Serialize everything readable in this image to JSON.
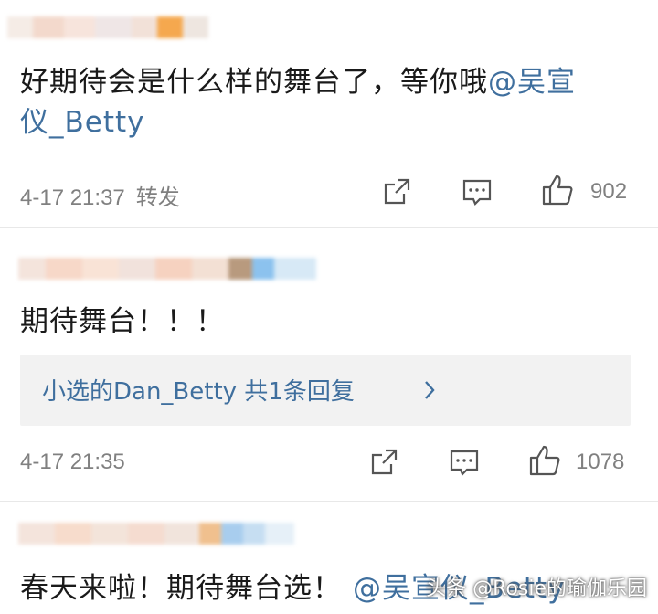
{
  "comments": [
    {
      "text": "好期待会是什么样的舞台了，等你哦",
      "mention_1": "@吴宣",
      "line2_mention": "仪_Betty",
      "time": "4-17 21:37",
      "forward_label": "转发",
      "likes": "902"
    },
    {
      "text": "期待舞台！！！",
      "reply_summary": "小选的Dan_Betty 共1条回复",
      "time": "4-17 21:35",
      "likes": "1078"
    },
    {
      "text": "春天来啦！期待舞台选！",
      "mention": "@吴宣仪_Betty"
    }
  ],
  "watermark": "头条 @Rosie的瑜伽乐园",
  "colors": {
    "link": "#3f6f9e",
    "meta": "#808080",
    "reply_bg": "#f2f2f2"
  },
  "icons": [
    "share-icon",
    "comment-icon",
    "like-icon",
    "chevron-right-icon"
  ]
}
